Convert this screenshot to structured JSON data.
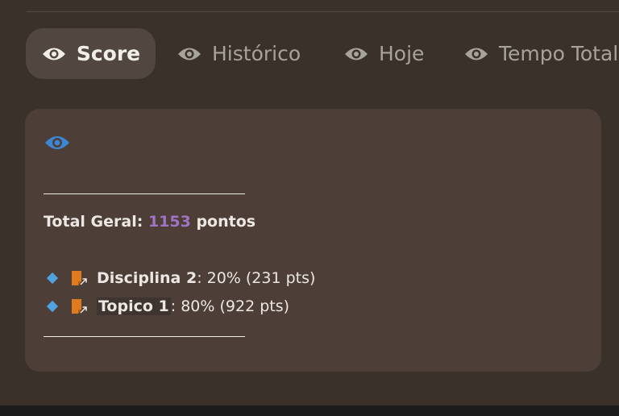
{
  "tabs": [
    {
      "label": "Score",
      "icon": "eye-icon",
      "active": true
    },
    {
      "label": "Histórico",
      "icon": "eye-icon",
      "active": false
    },
    {
      "label": "Hoje",
      "icon": "eye-icon",
      "active": false
    },
    {
      "label": "Tempo Total",
      "icon": "eye-icon",
      "active": false
    }
  ],
  "card": {
    "header_icon": "eye-icon",
    "header_icon_color": "#3d86d6",
    "total": {
      "label": "Total Geral:",
      "value": "1153",
      "unit": "pontos"
    },
    "items": [
      {
        "name": "Disciplina 2",
        "detail": ": 20% (231 pts)",
        "icon": "note-link-icon"
      },
      {
        "name": "Topico 1",
        "detail": ": 80% (922 pts)",
        "icon": "note-link-icon"
      }
    ]
  },
  "colors": {
    "background": "#3b312b",
    "card": "#4d3f38",
    "active_tab": "#514640",
    "highlight_number": "#a074c4",
    "bullet": "#4fa3e0",
    "note_icon": "#e07a1f"
  }
}
